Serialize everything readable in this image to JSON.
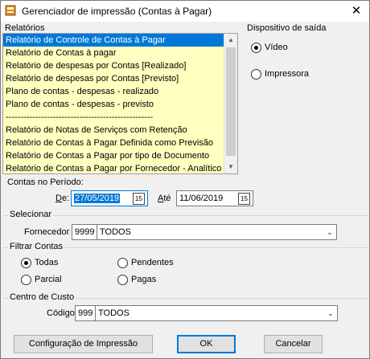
{
  "window": {
    "title": "Gerenciador de impressão (Contas à Pagar)",
    "close_glyph": "✕"
  },
  "reports": {
    "label": "Relatórios",
    "items": [
      "Relatório de Controle de Contas à Pagar",
      "Relatório de Contas à pagar",
      "Relatório de despesas por Contas [Realizado]",
      "Relatório de despesas por Contas [Previsto]",
      "Plano de contas - despesas - realizado",
      "Plano de contas - despesas - previsto",
      "--------------------------------------------------",
      "Relatório de Notas de Serviços com Retenção",
      "Relatório de Contas à Pagar Definida como Previsão",
      "Relatório de Contas a Pagar por tipo de Documento",
      "Relatório de Contas a Pagar por Fornecedor - Analítico"
    ],
    "selected_index": 0
  },
  "output": {
    "label": "Dispositivo de saída",
    "options": [
      "Vídeo",
      "Impressora"
    ],
    "selected": "Vídeo"
  },
  "period": {
    "label": "Contas no Período:",
    "from_label": "De:",
    "from_value": "27/05/2019",
    "to_label": "Até",
    "to_value": "11/06/2019",
    "calendar_glyph": "15"
  },
  "select": {
    "label": "Selecionar",
    "supplier_label": "Fornecedor",
    "supplier_code": "9999",
    "supplier_value": "TODOS"
  },
  "filter": {
    "label": "Filtrar Contas",
    "options": [
      "Todas",
      "Pendentes",
      "Parcial",
      "Pagas"
    ],
    "selected": "Todas"
  },
  "cost_center": {
    "label": "Centro de Custo",
    "code_label": "Código:",
    "code": "999",
    "value": "TODOS"
  },
  "buttons": {
    "config": "Configuração de Impressão",
    "ok": "OK",
    "cancel": "Cancelar"
  },
  "colors": {
    "list_bg": "#ffffc0",
    "selection": "#0078d7"
  }
}
